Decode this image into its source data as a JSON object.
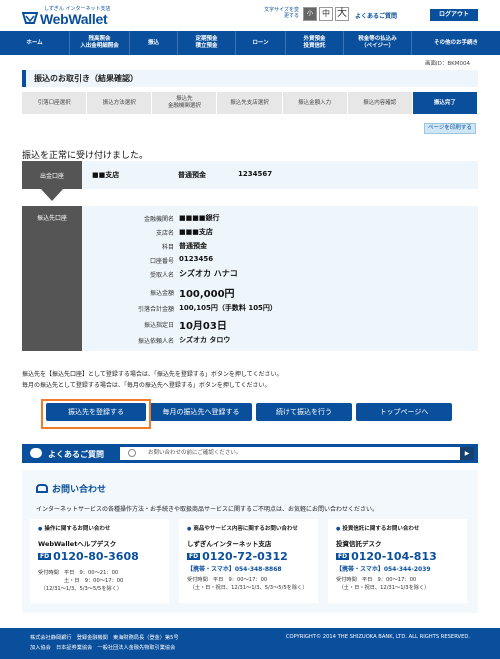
{
  "header": {
    "brand_sub": "しずぎん インターネット支店",
    "brand_name": "WebWallet",
    "fontsize_label": "文字サイズを変更する",
    "fontsize_small": "小",
    "fontsize_mid": "中",
    "fontsize_large": "大",
    "faq_link": "よくあるご質問",
    "logout": "ログアウト"
  },
  "nav": [
    "ホーム",
    "残高照会\n入出金明細照会",
    "振込",
    "定期預金\n積立預金",
    "ローン",
    "外貨預金\n投資信託",
    "税金等の払込み\n（ペイジー）",
    "その他のお手続き"
  ],
  "screen_id": "画面ID：BKM004",
  "page_title": "振込のお取引き（結果確認）",
  "steps": [
    "引落口座選択",
    "振込方法選択",
    "振込先\n金融機関選択",
    "振込先支店選択",
    "振込金額入力",
    "振込内容確認",
    "振込完了"
  ],
  "print_button": "ページを印刷する",
  "complete_message": "振込を正常に受け付けました。",
  "from": {
    "label": "出金口座",
    "branch": "■■支店",
    "type": "普通預金",
    "number": "1234567"
  },
  "to": {
    "label": "振込先口座",
    "rows": [
      {
        "label": "金融機関名",
        "value": "■■■■銀行"
      },
      {
        "label": "支店名",
        "value": "■■■支店"
      },
      {
        "label": "科目",
        "value": "普通預金"
      },
      {
        "label": "口座番号",
        "value": "0123456"
      },
      {
        "label": "受取人名",
        "value": "シズオカ ハナコ"
      },
      {
        "label": "振込金額",
        "value": "100,000円"
      },
      {
        "label": "引落合計金額",
        "value": "100,105円（手数料 105円）"
      },
      {
        "label": "振込指定日",
        "value": "10月03日"
      },
      {
        "label": "振込依頼人名",
        "value": "シズオカ タロウ"
      }
    ]
  },
  "note_line1": "振込先を【振込先口座】として登録する場合は、「振込先を登録する」ボタンを押してください。",
  "note_line2": "毎月の振込先として登録する場合は、「毎月の振込先へ登録する」ボタンを押してください。",
  "actions": {
    "register": "振込先を登録する",
    "monthly": "毎月の振込先へ登録する",
    "continue": "続けて振込を行う",
    "top": "トップページへ"
  },
  "faq": {
    "title": "よくあるご質問",
    "placeholder": "お問い合わせの前にご確認ください。",
    "go": "▶"
  },
  "contact": {
    "title": "お問い合わせ",
    "desc": "インターネットサービスの各種操作方法・お手続きや取扱商品サービスに関するご不明点は、お気軽にお問い合わせください。",
    "cards": [
      {
        "heading": "操作に関するお問い合わせ",
        "desk": "WebWalletヘルプデスク",
        "number": "0120-80-3608",
        "mobile": "",
        "hours": "受付時間　平日　9：00～21：00\n　　　　　土・日　9：00～17：00\n　（12/31～1/3、5/3～5/5を除く）"
      },
      {
        "heading": "商品やサービス内容に関するお問い合わせ",
        "desk": "しずぎんインターネット支店",
        "number": "0120-72-0312",
        "mobile": "【携帯・スマホ】054-348-8868",
        "hours": "受付時間　平日　9：00～17：00\n　（土・日・祝日、12/31～1/3、5/3～5/5を除く）"
      },
      {
        "heading": "投資信託に関するお問い合わせ",
        "desk": "投資信託デスク",
        "number": "0120-104-813",
        "mobile": "【携帯・スマホ】054-344-2039",
        "hours": "受付時間　平日　9：00～17：00\n　（土・日・祝日、12/31～1/3を除く）"
      }
    ],
    "fd_mark": "FD"
  },
  "footer": {
    "line1": "株式会社静岡銀行　登録金融機関　東海財務局長（登金）第5号",
    "line2": "加入協会　日本証券業協会　一般社団法人金融先物取引業協会",
    "copyright": "COPYRIGHT© 2014 THE SHIZUOKA BANK, LTD. ALL RIGHTS RESERVED."
  }
}
